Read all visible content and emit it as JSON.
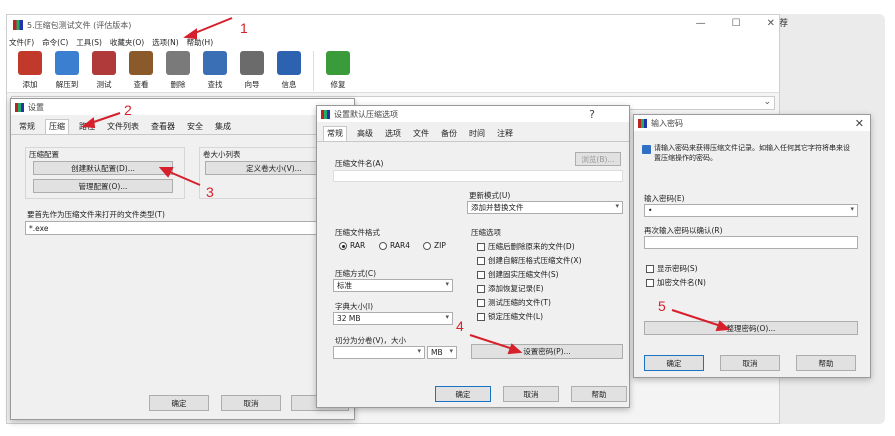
{
  "main_window": {
    "title": "5.压缩包测试文件 (评估版本)",
    "menu": [
      "文件(F)",
      "命令(C)",
      "工具(S)",
      "收藏夹(O)",
      "选项(N)",
      "帮助(H)"
    ],
    "toolbar": [
      {
        "label": "添加",
        "icon": "add-archive-icon",
        "color": "#c0392b"
      },
      {
        "label": "解压到",
        "icon": "extract-folder-icon",
        "color": "#3b7fd1"
      },
      {
        "label": "测试",
        "icon": "test-clipboard-icon",
        "color": "#b03a3a"
      },
      {
        "label": "查看",
        "icon": "view-book-icon",
        "color": "#8a5a2b"
      },
      {
        "label": "删除",
        "icon": "trash-icon",
        "color": "#7a7a7a"
      },
      {
        "label": "查找",
        "icon": "search-magnifier-icon",
        "color": "#3a6fb5"
      },
      {
        "label": "向导",
        "icon": "wizard-wand-icon",
        "color": "#6b6b6b"
      },
      {
        "label": "信息",
        "icon": "info-icon",
        "color": "#2d62b0"
      },
      {
        "label": "修复",
        "icon": "repair-kit-icon",
        "color": "#3a9b3a"
      }
    ],
    "window_controls": [
      "—",
      "☐",
      "✕"
    ]
  },
  "right_panel": {
    "label": "荐"
  },
  "settings_dialog": {
    "title": "设置",
    "tabs": [
      "常规",
      "压缩",
      "路径",
      "文件列表",
      "查看器",
      "安全",
      "集成"
    ],
    "active_tab": "压缩",
    "group_compress_config": "压缩配置",
    "create_default_button": "创建默认配置(D)...",
    "organize_button": "管理配置(O)...",
    "group_volume_list": "卷大小列表",
    "define_volume_button": "定义卷大小(V)...",
    "file_types_label": "要首先作为压缩文件来打开的文件类型(T)",
    "file_types_value": "*.exe",
    "ok": "确定",
    "cancel": "取消"
  },
  "default_options_dialog": {
    "title": "设置默认压缩选项",
    "help_mark": "?",
    "tabs": [
      "常规",
      "高级",
      "选项",
      "文件",
      "备份",
      "时间",
      "注释"
    ],
    "active_tab": "常规",
    "archive_name_label": "压缩文件名(A)",
    "browse_button": "浏览(B)...",
    "update_mode_label": "更新模式(U)",
    "update_mode_value": "添加并替换文件",
    "format_label": "压缩文件格式",
    "formats": [
      "RAR",
      "RAR4",
      "ZIP"
    ],
    "selected_format": "RAR",
    "options_label": "压缩选项",
    "options": [
      "压缩后删除原来的文件(D)",
      "创建自解压格式压缩文件(X)",
      "创建固实压缩文件(S)",
      "添加恢复记录(E)",
      "测试压缩的文件(T)",
      "锁定压缩文件(L)"
    ],
    "method_label": "压缩方式(C)",
    "method_value": "标准",
    "dict_label": "字典大小(I)",
    "dict_value": "32 MB",
    "split_label": "切分为分卷(V)，大小",
    "split_unit": "MB",
    "set_password_button": "设置密码(P)...",
    "ok": "确定",
    "cancel": "取消",
    "help": "帮助"
  },
  "password_dialog": {
    "title": "输入密码",
    "description": "请输入密码来获得压缩文件记录。如输入任何其它字符将串来设置压缩操作的密码。",
    "enter_label": "输入密码(E)",
    "enter_value": "•",
    "reenter_label": "再次输入密码以确认(R)",
    "show_password": "显示密码(S)",
    "encrypt_names": "加密文件名(N)",
    "organize_button": "整理密码(O)...",
    "ok": "确定",
    "cancel": "取消",
    "help": "帮助"
  },
  "annotations": [
    "1",
    "2",
    "3",
    "4",
    "5"
  ],
  "colors": {
    "annotation": "#d6202b"
  }
}
